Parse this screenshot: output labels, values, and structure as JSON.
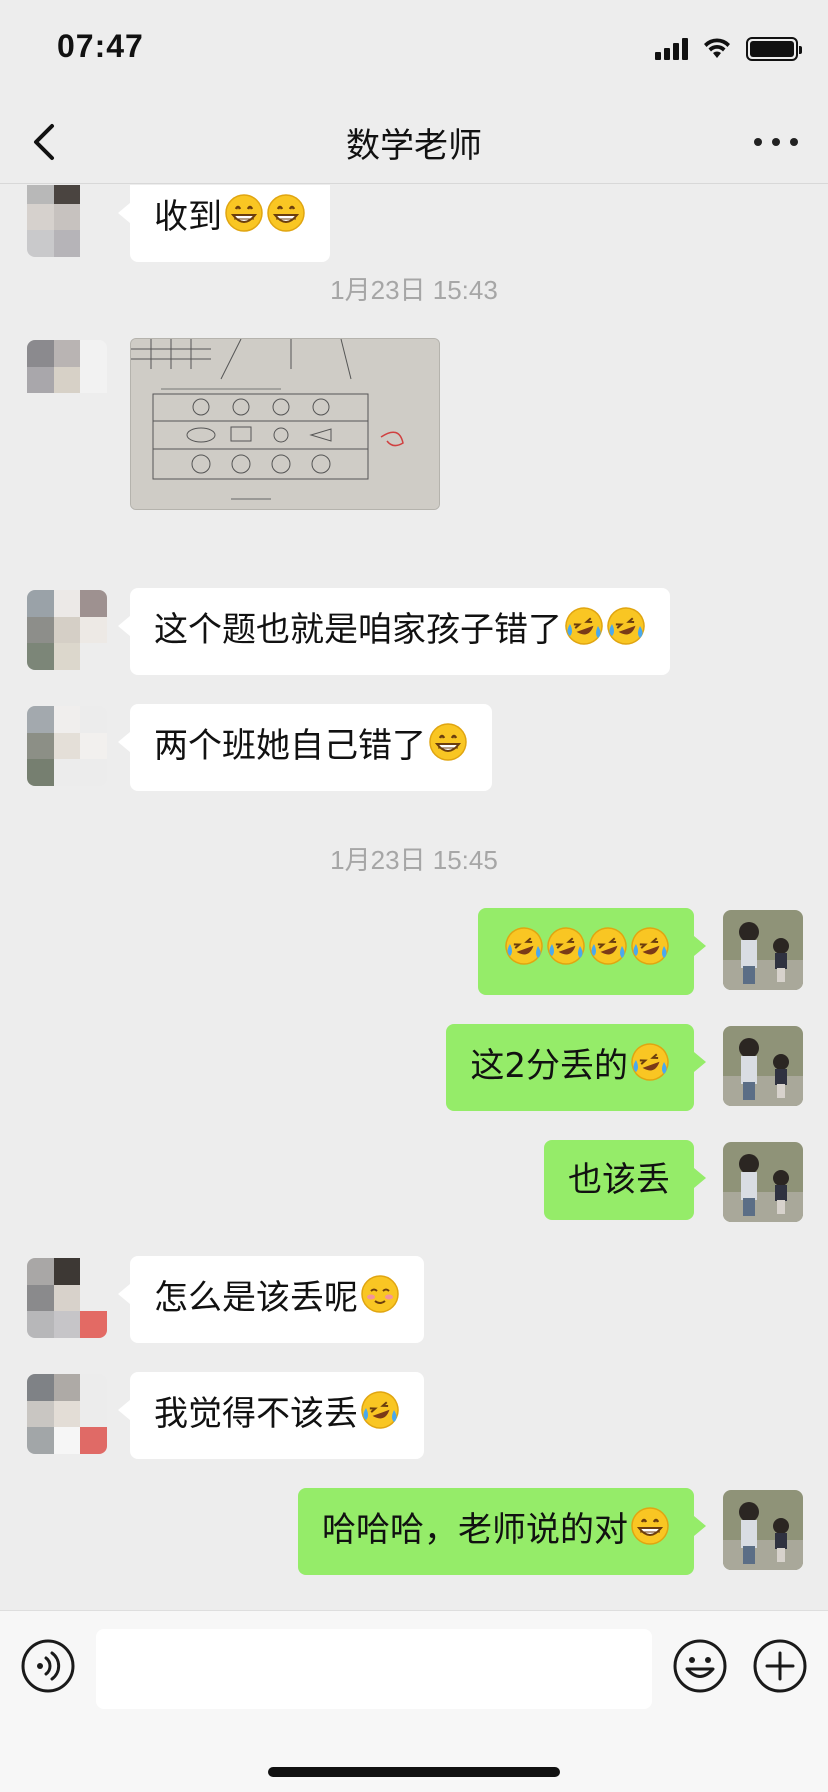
{
  "status_bar": {
    "time": "07:47"
  },
  "nav": {
    "title": "数学老师"
  },
  "messages": [
    {
      "side": "left",
      "text": "收到",
      "emojis": [
        "grin",
        "grin"
      ]
    },
    {
      "type": "timestamp",
      "text": "1月23日 15:43"
    },
    {
      "side": "left",
      "type": "image"
    },
    {
      "side": "left",
      "text": "这个题也就是咱家孩子错了",
      "emojis": [
        "laughcry",
        "laughcry"
      ]
    },
    {
      "side": "left",
      "text": "两个班她自己错了",
      "emojis": [
        "grin"
      ]
    },
    {
      "type": "timestamp",
      "text": "1月23日 15:45"
    },
    {
      "side": "right",
      "text": "",
      "emojis": [
        "laughcry",
        "laughcry",
        "laughcry",
        "laughcry"
      ]
    },
    {
      "side": "right",
      "text": "这2分丢的",
      "emojis": [
        "laughcry"
      ]
    },
    {
      "side": "right",
      "text": "也该丢",
      "emojis": []
    },
    {
      "side": "left",
      "text": "怎么是该丢呢",
      "emojis": [
        "blush"
      ]
    },
    {
      "side": "left",
      "text": "我觉得不该丢",
      "emojis": [
        "laughcry"
      ]
    },
    {
      "side": "right",
      "text": "哈哈哈，老师说的对",
      "emojis": [
        "grin"
      ]
    }
  ],
  "input": {
    "placeholder": ""
  },
  "icons": {
    "back": "chevron-left-icon",
    "more": "more-dots-icon",
    "voice": "voice-icon",
    "emoji": "smiley-icon",
    "plus": "plus-icon"
  },
  "colors": {
    "background": "#ededed",
    "outgoing_bubble": "#95ec69",
    "incoming_bubble": "#ffffff",
    "timestamp": "#a6a6a6"
  }
}
